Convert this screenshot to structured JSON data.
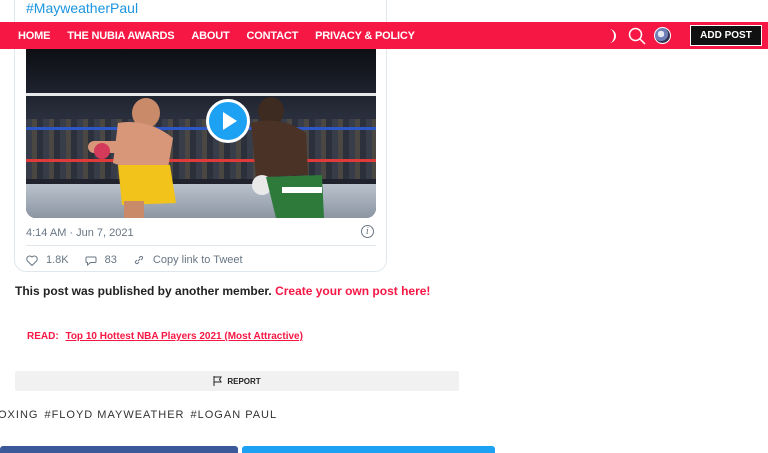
{
  "tweet": {
    "hashtag": "#MayweatherPaul",
    "timestamp": "4:14 AM · Jun 7, 2021",
    "likes": "1.8K",
    "replies": "83",
    "copy_link": "Copy link to Tweet"
  },
  "nav": {
    "links": [
      "HOME",
      "THE NUBIA AWARDS",
      "ABOUT",
      "CONTACT",
      "PRIVACY & POLICY"
    ],
    "add_post": "ADD POST"
  },
  "content": {
    "published_text": "This post was published by another member.",
    "published_link": "Create your own post here!",
    "read_label": "READ:",
    "read_link": "Top 10 Hottest NBA Players 2021 (Most Attractive)",
    "report": "REPORT",
    "tags": [
      "OXING",
      "#FLOYD MAYWEATHER",
      "#LOGAN PAUL"
    ]
  },
  "colors": {
    "accent": "#f61744",
    "twitter_blue": "#1da1f2",
    "facebook_blue": "#3b5998"
  }
}
